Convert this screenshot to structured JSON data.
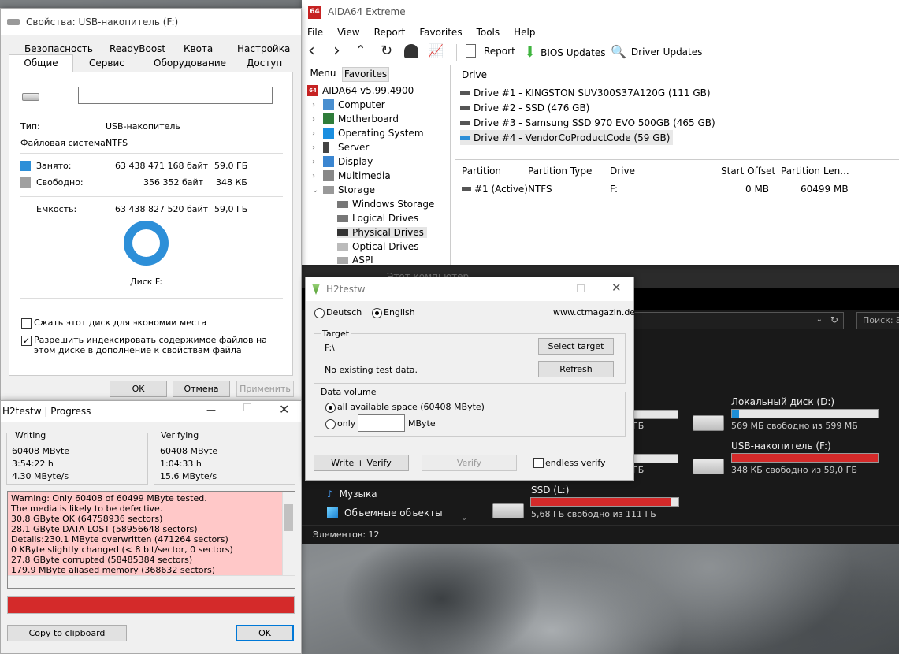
{
  "colors": {
    "accent": "#1e8fd6",
    "error": "#d42a2a",
    "log_bg": "#ffc8c8",
    "used": "#2d8fd8",
    "free": "#a0a0a0"
  },
  "props": {
    "title": "Свойства: USB-накопитель (F:)",
    "tabs_row1": [
      "Безопасность",
      "ReadyBoost",
      "Квота",
      "Настройка"
    ],
    "tabs_row2": [
      "Общие",
      "Сервис",
      "Оборудование",
      "Доступ"
    ],
    "type_label": "Тип:",
    "type_value": "USB-накопитель",
    "fs_label": "Файловая система:",
    "fs_value": "NTFS",
    "used_label": "Занято:",
    "used_bytes": "63 438 471 168 байт",
    "used_human": "59,0 ГБ",
    "free_label": "Свободно:",
    "free_bytes": "356 352 байт",
    "free_human": "348 КБ",
    "cap_label": "Емкость:",
    "cap_bytes": "63 438 827 520 байт",
    "cap_human": "59,0 ГБ",
    "disk_label": "Диск F:",
    "compress_label": "Сжать этот диск для экономии места",
    "index_label": "Разрешить индексировать содержимое файлов на этом диске в дополнение к свойствам файла",
    "ok": "OK",
    "cancel": "Отмена",
    "apply": "Применить"
  },
  "aida": {
    "title": "AIDA64 Extreme",
    "menu": [
      "File",
      "View",
      "Report",
      "Favorites",
      "Tools",
      "Help"
    ],
    "toolbar": {
      "report": "Report",
      "bios": "BIOS Updates",
      "driver": "Driver Updates"
    },
    "tabs": [
      "Menu",
      "Favorites"
    ],
    "tree": {
      "root": "AIDA64 v5.99.4900",
      "computer": "Computer",
      "motherboard": "Motherboard",
      "os": "Operating System",
      "server": "Server",
      "display": "Display",
      "multimedia": "Multimedia",
      "storage": "Storage",
      "win_storage": "Windows Storage",
      "logical": "Logical Drives",
      "physical": "Physical Drives",
      "optical": "Optical Drives",
      "aspi": "ASPI"
    },
    "drive_header": "Drive",
    "drives": [
      "Drive #1 - KINGSTON SUV300S37A120G (111 GB)",
      "Drive #2 - SSD (476 GB)",
      "Drive #3 - Samsung SSD 970 EVO 500GB (465 GB)",
      "Drive #4 - VendorCoProductCode (59 GB)"
    ],
    "part_cols": [
      "Partition",
      "Partition Type",
      "Drive",
      "Start Offset",
      "Partition Len..."
    ],
    "part_row": [
      "#1 (Active)",
      "NTFS",
      "F:",
      "0 MB",
      "60499 MB"
    ]
  },
  "explorer": {
    "title": "Этот компьютер",
    "search": "Поиск: Э",
    "nav": [
      "Музыка",
      "Объемные объекты"
    ],
    "status": "Элементов: 12",
    "drives": [
      {
        "name": "Локальный диск (D:)",
        "free": "569 МБ свободно из 599 МБ",
        "fill": 0.05,
        "red": false
      },
      {
        "name": "USB-накопитель (F:)",
        "free": "348 КБ свободно из 59,0 ГБ",
        "fill": 1.0,
        "red": true
      },
      {
        "name": "SSD (L:)",
        "free": "5,68 ГБ свободно из 111 ГБ",
        "fill": 0.95,
        "red": true
      }
    ],
    "partial_free": [
      "ГБ",
      "ГБ"
    ]
  },
  "h2": {
    "title": "H2testw",
    "lang_de": "Deutsch",
    "lang_en": "English",
    "site": "www.ctmagazin.de",
    "target_legend": "Target",
    "target_path": "F:\\",
    "no_data": "No existing test data.",
    "select_target": "Select target",
    "refresh": "Refresh",
    "volume_legend": "Data volume",
    "all_space": "all available space (60408 MByte)",
    "only": "only",
    "mbyte": "MByte",
    "write_verify": "Write + Verify",
    "verify": "Verify",
    "endless": "endless verify"
  },
  "progress": {
    "title": "H2testw | Progress",
    "writing": "Writing",
    "w1": "60408 MByte",
    "w2": "3:54:22 h",
    "w3": "4.30 MByte/s",
    "verifying": "Verifying",
    "v1": "60408 MByte",
    "v2": "1:04:33 h",
    "v3": "15.6 MByte/s",
    "log": [
      "Warning: Only 60408 of 60499 MByte tested.",
      "The media is likely to be defective.",
      "30.8 GByte OK (64758936 sectors)",
      "28.1 GByte DATA LOST (58956648 sectors)",
      "Details:230.1 MByte overwritten (471264 sectors)",
      "0 KByte slightly changed (< 8 bit/sector, 0 sectors)",
      "27.8 GByte corrupted (58485384 sectors)",
      "179.9 MByte aliased memory (368632 sectors)"
    ],
    "progress": 1.0,
    "copy": "Copy to clipboard",
    "ok": "OK"
  }
}
